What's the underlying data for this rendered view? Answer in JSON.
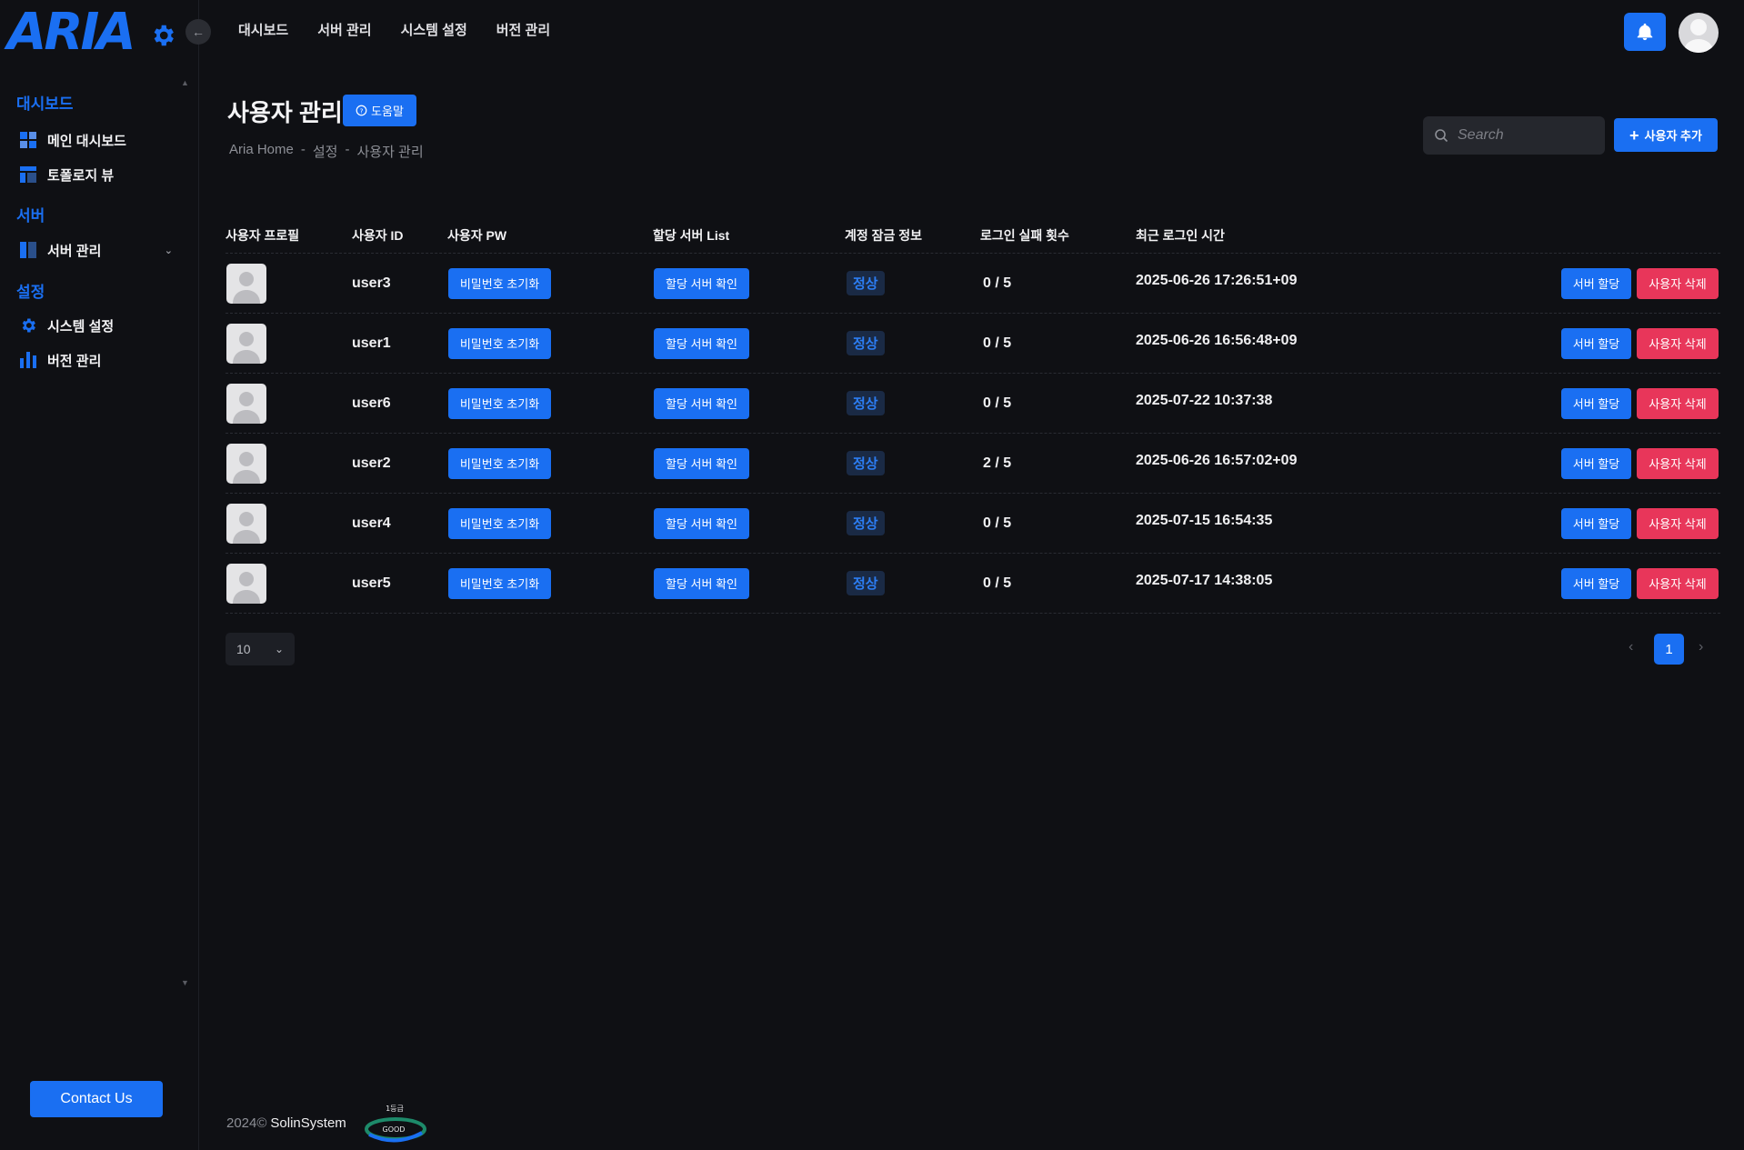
{
  "app": {
    "logo_text": "ARIA"
  },
  "top_nav": [
    "대시보드",
    "서버 관리",
    "시스템 설정",
    "버전 관리"
  ],
  "sidebar": {
    "sections": [
      {
        "title": "대시보드",
        "items": [
          {
            "label": "메인 대시보드",
            "icon": "dashboard-grid-icon"
          },
          {
            "label": "토폴로지 뷰",
            "icon": "layout-icon"
          }
        ]
      },
      {
        "title": "서버",
        "items": [
          {
            "label": "서버 관리",
            "icon": "server-panel-icon",
            "has_submenu": true
          }
        ]
      },
      {
        "title": "설정",
        "items": [
          {
            "label": "시스템 설정",
            "icon": "gear-icon"
          },
          {
            "label": "버전 관리",
            "icon": "bar-chart-icon"
          }
        ]
      }
    ],
    "contact_label": "Contact Us"
  },
  "page": {
    "title": "사용자 관리",
    "help_label": "도움말",
    "breadcrumb": [
      "Aria Home",
      "-",
      "설정",
      "-",
      "사용자 관리"
    ],
    "search_placeholder": "Search",
    "add_user_label": "사용자 추가"
  },
  "table": {
    "columns": [
      "사용자 프로필",
      "사용자 ID",
      "사용자 PW",
      "할당 서버 List",
      "계정 잠금 정보",
      "로그인 실패 횟수",
      "최근 로그인 시간"
    ],
    "reset_pw_label": "비밀번호 초기화",
    "check_servers_label": "할당 서버 확인",
    "assign_label": "서버 할당",
    "delete_label": "사용자 삭제",
    "rows": [
      {
        "user_id": "user3",
        "status": "정상",
        "fails": "0 / 5",
        "last_login": "2025-06-26 17:26:51+09"
      },
      {
        "user_id": "user1",
        "status": "정상",
        "fails": "0 / 5",
        "last_login": "2025-06-26 16:56:48+09"
      },
      {
        "user_id": "user6",
        "status": "정상",
        "fails": "0 / 5",
        "last_login": "2025-07-22 10:37:38"
      },
      {
        "user_id": "user2",
        "status": "정상",
        "fails": "2 / 5",
        "last_login": "2025-06-26 16:57:02+09"
      },
      {
        "user_id": "user4",
        "status": "정상",
        "fails": "0 / 5",
        "last_login": "2025-07-15 16:54:35"
      },
      {
        "user_id": "user5",
        "status": "정상",
        "fails": "0 / 5",
        "last_login": "2025-07-17 14:38:05"
      }
    ]
  },
  "pagination": {
    "page_size": "10",
    "current_page": "1",
    "prev": "‹",
    "next": "›"
  },
  "footer": {
    "year": "2024©",
    "company": "SolinSystem",
    "badge_grade": "1등급",
    "badge_text": "GOOD"
  },
  "colors": {
    "accent": "#1a6ff2",
    "danger": "#e8365a",
    "background": "#0f1014"
  }
}
